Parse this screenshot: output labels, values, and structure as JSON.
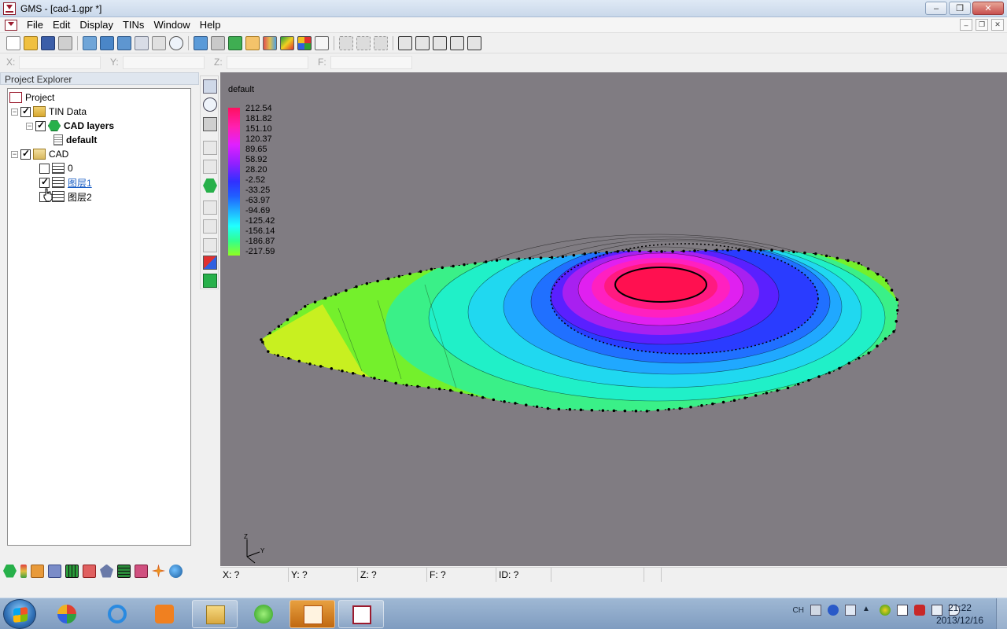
{
  "window": {
    "title": "GMS - [cad-1.gpr *]"
  },
  "menu": {
    "items": [
      "File",
      "Edit",
      "Display",
      "TINs",
      "Window",
      "Help"
    ]
  },
  "coords": {
    "x_label": "X:",
    "y_label": "Y:",
    "z_label": "Z:",
    "f_label": "F:"
  },
  "explorer": {
    "title": "Project Explorer",
    "project_label": "Project",
    "tin_data": {
      "label": "TIN Data",
      "checked": true
    },
    "cad_layers": {
      "label": "CAD layers",
      "checked": true
    },
    "default_item": {
      "label": "default"
    },
    "cad": {
      "label": "CAD",
      "checked": true
    },
    "layers": [
      {
        "label": "0",
        "checked": false
      },
      {
        "label": "图层1",
        "checked": true
      },
      {
        "label": "图层2",
        "checked": false
      }
    ]
  },
  "view": {
    "dataset_label": "default",
    "legend_values": [
      "212.54",
      "181.82",
      "151.10",
      "120.37",
      "89.65",
      "58.92",
      "28.20",
      "-2.52",
      "-33.25",
      "-63.97",
      "-94.69",
      "-125.42",
      "-156.14",
      "-186.87",
      "-217.59"
    ]
  },
  "status": {
    "x": "X: ?",
    "y": "Y: ?",
    "z": "Z: ?",
    "f": "F: ?",
    "id": "ID: ?"
  },
  "taskbar": {
    "lang": "CH",
    "time": "21:22",
    "date": "2013/12/16"
  },
  "colors": {
    "view_bg": "#807c82",
    "brand": "#9b1b2e"
  }
}
